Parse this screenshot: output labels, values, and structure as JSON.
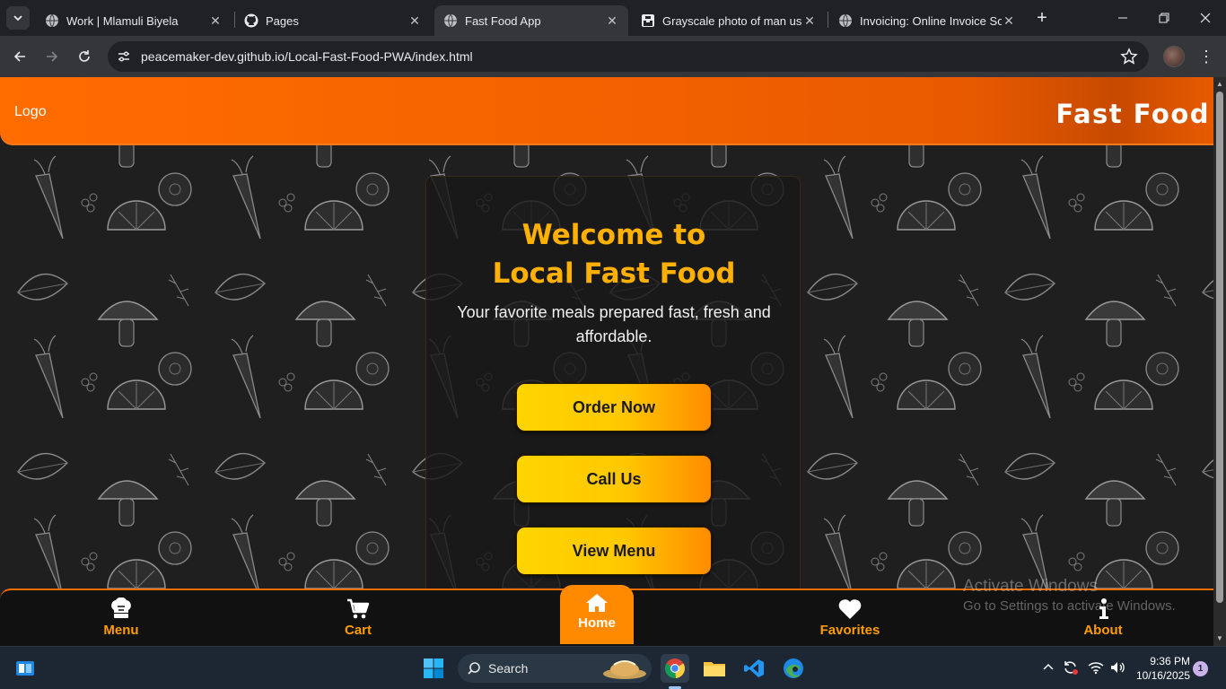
{
  "browser": {
    "tabs": [
      {
        "title": "Work | Mlamuli Biyela",
        "icon": "globe-icon",
        "active": false
      },
      {
        "title": "Pages",
        "icon": "github-icon",
        "active": false
      },
      {
        "title": "Fast Food App",
        "icon": "globe-icon",
        "active": true
      },
      {
        "title": "Grayscale photo of man usin",
        "icon": "unsplash-icon",
        "active": false
      },
      {
        "title": "Invoicing: Online Invoice Sof",
        "icon": "globe-icon",
        "active": false
      }
    ],
    "url": "peacemaker-dev.github.io/Local-Fast-Food-PWA/index.html"
  },
  "page": {
    "logo_alt": "Logo",
    "brand": "Fast Food",
    "hero": {
      "title_line1": "Welcome to",
      "title_line2": "Local Fast Food",
      "subtitle": "Your favorite meals prepared fast, fresh and affordable.",
      "buttons": [
        "Order Now",
        "Call Us",
        "View Menu"
      ]
    },
    "bottom_nav": [
      {
        "label": "Menu",
        "icon": "chef-hat-icon"
      },
      {
        "label": "Cart",
        "icon": "cart-icon"
      },
      {
        "label": "Home",
        "icon": "home-icon",
        "active": true
      },
      {
        "label": "Favorites",
        "icon": "heart-icon"
      },
      {
        "label": "About",
        "icon": "info-icon"
      }
    ],
    "colors": {
      "accent": "#ff6d00",
      "title": "#ffb000",
      "nav_text": "#ff9d00"
    }
  },
  "watermark": {
    "line1": "Activate Windows",
    "line2": "Go to Settings to activate Windows."
  },
  "taskbar": {
    "search_label": "Search",
    "time": "9:36 PM",
    "date": "10/16/2025",
    "notification_count": "1"
  }
}
